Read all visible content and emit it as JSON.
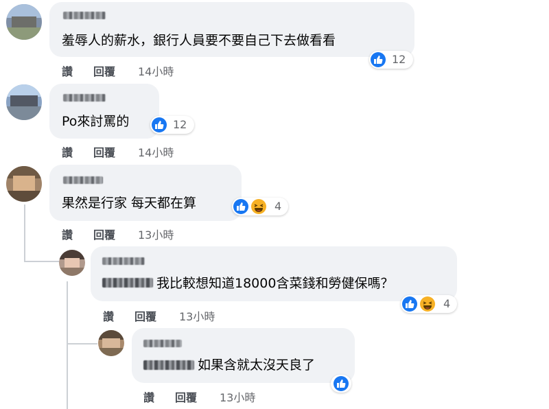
{
  "comments": [
    {
      "text": "羞辱人的薪水，銀行人員要不要自己下去做看看",
      "reaction_count": "12",
      "actions": {
        "like": "讚",
        "reply": "回覆",
        "time": "14小時"
      }
    },
    {
      "text": "Po來討罵的",
      "reaction_count": "12",
      "actions": {
        "like": "讚",
        "reply": "回覆",
        "time": "14小時"
      }
    },
    {
      "text": "果然是行家 每天都在算",
      "reaction_count": "4",
      "actions": {
        "like": "讚",
        "reply": "回覆",
        "time": "13小時"
      }
    },
    {
      "text": "我比較想知道18000含菜錢和勞健保嗎？",
      "reaction_count": "4",
      "actions": {
        "like": "讚",
        "reply": "回覆",
        "time": "13小時"
      }
    },
    {
      "text": "如果含就太沒天良了",
      "reaction_count": "",
      "actions": {
        "like": "讚",
        "reply": "回覆",
        "time": "13小時"
      }
    }
  ],
  "icons": {
    "like": "like-thumb-icon",
    "haha": "haha-emoji-icon"
  },
  "colors": {
    "bubble": "#f0f2f5",
    "like": "#1877f2",
    "haha": "#f7b125",
    "meta": "#65676b"
  }
}
